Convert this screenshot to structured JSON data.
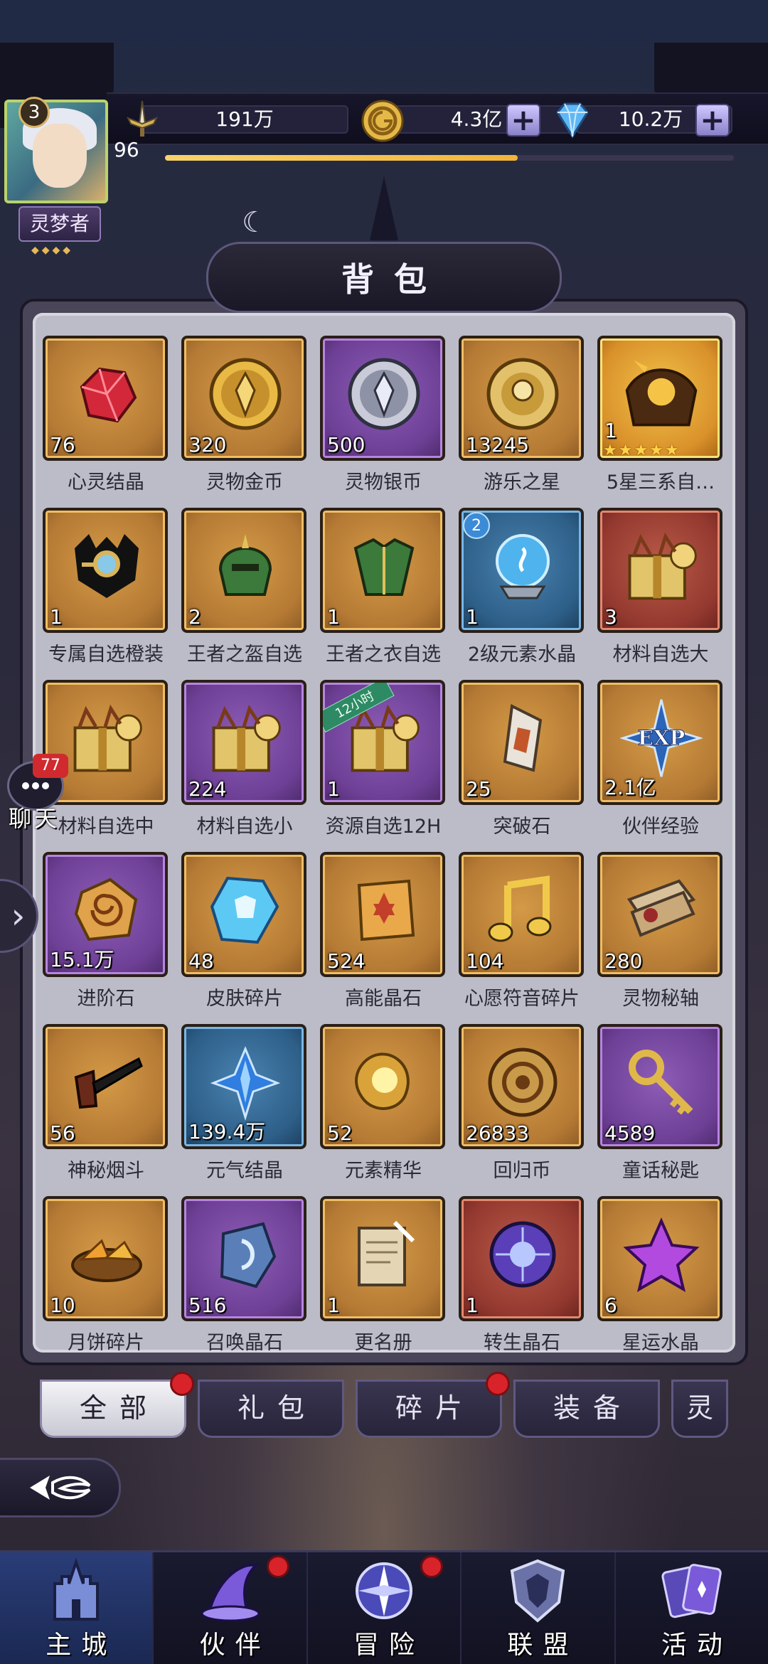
{
  "player": {
    "level": "3",
    "exp_level": "96",
    "title": "灵梦者",
    "exp_progress": 0.62
  },
  "resources": {
    "power": "191万",
    "gold": "4.3亿",
    "diamond": "10.2万"
  },
  "panel": {
    "title": "背包"
  },
  "items": [
    {
      "name": "心灵结晶",
      "qty": "76",
      "rarity": "gold",
      "icon": "red-crystal-icon"
    },
    {
      "name": "灵物金币",
      "qty": "320",
      "rarity": "gold",
      "icon": "gold-coin-icon"
    },
    {
      "name": "灵物银币",
      "qty": "500",
      "rarity": "purple",
      "icon": "silver-coin-icon"
    },
    {
      "name": "游乐之星",
      "qty": "13245",
      "rarity": "gold",
      "icon": "bell-coin-icon"
    },
    {
      "name": "5星三系自…",
      "qty": "1",
      "rarity": "orange",
      "icon": "hero-chest-icon",
      "stars": "★★★★★"
    },
    {
      "name": "专属自选橙装",
      "qty": "1",
      "rarity": "gold",
      "icon": "magnifier-icon"
    },
    {
      "name": "王者之盔自选",
      "qty": "2",
      "rarity": "gold",
      "icon": "helmet-icon"
    },
    {
      "name": "王者之衣自选",
      "qty": "1",
      "rarity": "gold",
      "icon": "armor-icon"
    },
    {
      "name": "2级元素水晶",
      "qty": "1",
      "rarity": "blue",
      "icon": "crystal-ball-icon",
      "badge": "2"
    },
    {
      "name": "材料自选大",
      "qty": "3",
      "rarity": "red",
      "icon": "gift-box-icon"
    },
    {
      "name": "材料自选中",
      "qty": "3",
      "rarity": "gold",
      "icon": "gift-box-icon"
    },
    {
      "name": "材料自选小",
      "qty": "224",
      "rarity": "purple",
      "icon": "gift-box-icon"
    },
    {
      "name": "资源自选12H",
      "qty": "1",
      "rarity": "purple",
      "icon": "gift-box-icon",
      "ribbon": "12小时"
    },
    {
      "name": "突破石",
      "qty": "25",
      "rarity": "gold",
      "icon": "breakthrough-stone-icon"
    },
    {
      "name": "伙伴经验",
      "qty": "2.1亿",
      "rarity": "gold",
      "icon": "exp-star-icon",
      "label": "EXP"
    },
    {
      "name": "进阶石",
      "qty": "15.1万",
      "rarity": "purple",
      "icon": "spiral-stone-icon"
    },
    {
      "name": "皮肤碎片",
      "qty": "48",
      "rarity": "gold",
      "icon": "skin-shard-icon"
    },
    {
      "name": "高能晶石",
      "qty": "524",
      "rarity": "gold",
      "icon": "energy-crystal-icon"
    },
    {
      "name": "心愿符音碎片",
      "qty": "104",
      "rarity": "gold",
      "icon": "music-note-icon"
    },
    {
      "name": "灵物秘轴",
      "qty": "280",
      "rarity": "gold",
      "icon": "scroll-icon"
    },
    {
      "name": "神秘烟斗",
      "qty": "56",
      "rarity": "gold",
      "icon": "pipe-icon"
    },
    {
      "name": "元气结晶",
      "qty": "139.4万",
      "rarity": "blue",
      "icon": "blue-crystal-icon"
    },
    {
      "name": "元素精华",
      "qty": "52",
      "rarity": "gold",
      "icon": "element-essence-icon"
    },
    {
      "name": "回归币",
      "qty": "26833",
      "rarity": "gold",
      "icon": "return-coin-icon"
    },
    {
      "name": "童话秘匙",
      "qty": "4589",
      "rarity": "purple",
      "icon": "key-icon"
    },
    {
      "name": "月饼碎片",
      "qty": "10",
      "rarity": "gold",
      "icon": "mooncake-icon"
    },
    {
      "name": "召唤晶石",
      "qty": "516",
      "rarity": "purple",
      "icon": "summon-stone-icon"
    },
    {
      "name": "更名册",
      "qty": "1",
      "rarity": "gold",
      "icon": "rename-scroll-icon"
    },
    {
      "name": "转生晶石",
      "qty": "1",
      "rarity": "red",
      "icon": "rebirth-orb-icon"
    },
    {
      "name": "星运水晶",
      "qty": "6",
      "rarity": "gold",
      "icon": "purple-star-icon"
    }
  ],
  "tabs": [
    {
      "label": "全部",
      "active": true,
      "dot": true
    },
    {
      "label": "礼包",
      "active": false,
      "dot": false
    },
    {
      "label": "碎片",
      "active": false,
      "dot": true
    },
    {
      "label": "装备",
      "active": false,
      "dot": false
    },
    {
      "label": "灵",
      "active": false,
      "dot": false,
      "partial": true
    }
  ],
  "chat": {
    "count": "77",
    "label": "聊天"
  },
  "nav": [
    {
      "label": "主城",
      "icon": "castle-icon",
      "active": true,
      "dot": false
    },
    {
      "label": "伙伴",
      "icon": "wizard-hat-icon",
      "active": false,
      "dot": true
    },
    {
      "label": "冒险",
      "icon": "compass-icon",
      "active": false,
      "dot": true
    },
    {
      "label": "联盟",
      "icon": "shield-icon",
      "active": false,
      "dot": false
    },
    {
      "label": "活动",
      "icon": "cards-icon",
      "active": false,
      "dot": false
    }
  ],
  "colors": {
    "rarity_gold": "#b57a34",
    "rarity_purple": "#6d3f95",
    "rarity_blue": "#2d5f88",
    "rarity_red": "#94392f",
    "rarity_orange": "#d9912a",
    "red_dot": "#d8232a"
  }
}
